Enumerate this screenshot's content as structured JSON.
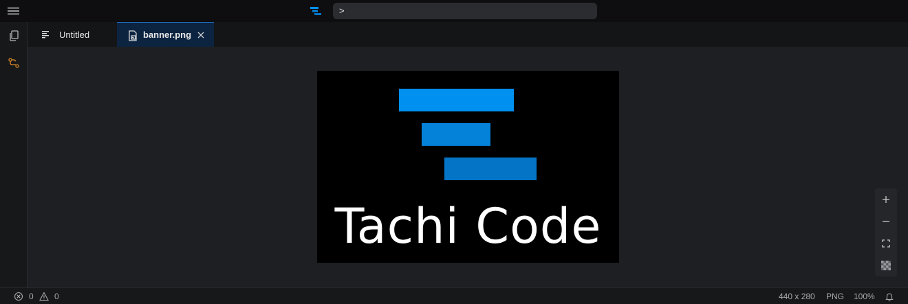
{
  "titlebar": {
    "command_prompt": ">"
  },
  "tabs": [
    {
      "label": "Untitled",
      "icon": "text-file-icon"
    },
    {
      "label": "banner.png",
      "icon": "image-file-icon",
      "active": true
    }
  ],
  "image": {
    "title_text": "Tachi Code",
    "colors": {
      "bar1": "#0090f0",
      "bar2": "#0482da",
      "bar3": "#0474c6",
      "background": "#000000"
    }
  },
  "zoom_controls": [
    "zoom-in-icon",
    "zoom-out-icon",
    "fit-screen-icon",
    "checkerboard-icon"
  ],
  "statusbar": {
    "errors": "0",
    "warnings": "0",
    "dimensions": "440 x 280",
    "format": "PNG",
    "zoom": "100%"
  },
  "accent": "#1f6fbf"
}
